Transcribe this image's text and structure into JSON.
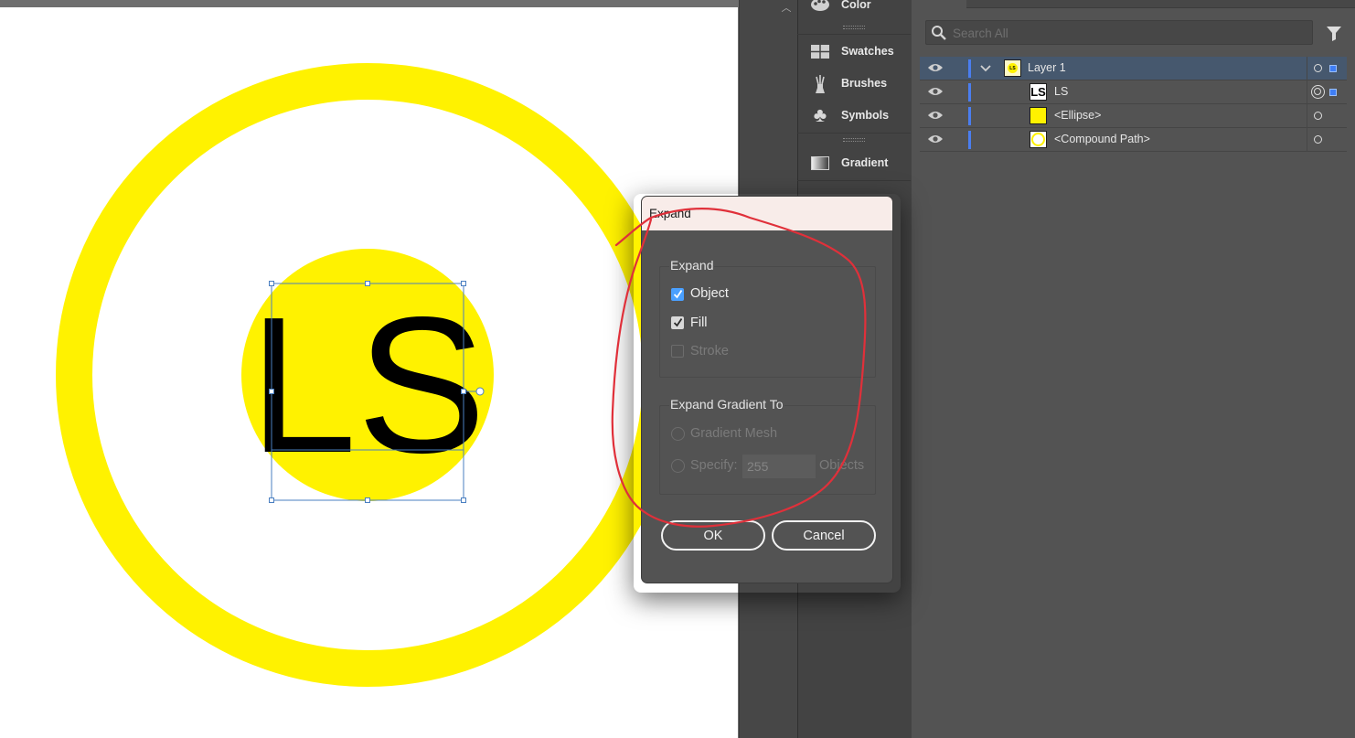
{
  "artwork": {
    "logo_text": "LS",
    "colors": {
      "yellow": "#fff200",
      "black": "#000000",
      "selection": "#4a7fc1"
    }
  },
  "dock_panels": [
    {
      "label": "Color",
      "icon": "palette-icon"
    },
    {
      "label": "Swatches",
      "icon": "swatches-grid-icon"
    },
    {
      "label": "Brushes",
      "icon": "brush-icon"
    },
    {
      "label": "Symbols",
      "icon": "club-symbol-icon"
    },
    {
      "label": "Gradient",
      "icon": "gradient-icon"
    }
  ],
  "layers_panel": {
    "search_placeholder": "Search All",
    "rows": [
      {
        "name": "Layer 1",
        "thumb": "LS",
        "selected": true
      },
      {
        "name": "LS",
        "thumb": "LS",
        "selected": false
      },
      {
        "name": "<Ellipse>",
        "thumb": "yellow-square",
        "selected": false
      },
      {
        "name": "<Compound Path>",
        "thumb": "yellow-ring",
        "selected": false
      }
    ]
  },
  "expand_dialog": {
    "title": "Expand",
    "expand_group_label": "Expand",
    "object_label": "Object",
    "object_checked": true,
    "fill_label": "Fill",
    "fill_checked": true,
    "stroke_label": "Stroke",
    "stroke_checked": false,
    "gradient_group_label": "Expand Gradient To",
    "gradient_mesh_label": "Gradient Mesh",
    "specify_label": "Specify:",
    "specify_value": "255",
    "objects_label": "Objects",
    "ok_label": "OK",
    "cancel_label": "Cancel"
  },
  "annotation": {
    "color": "#e0303a",
    "shape": "hand-drawn circle around Expand dialog"
  }
}
